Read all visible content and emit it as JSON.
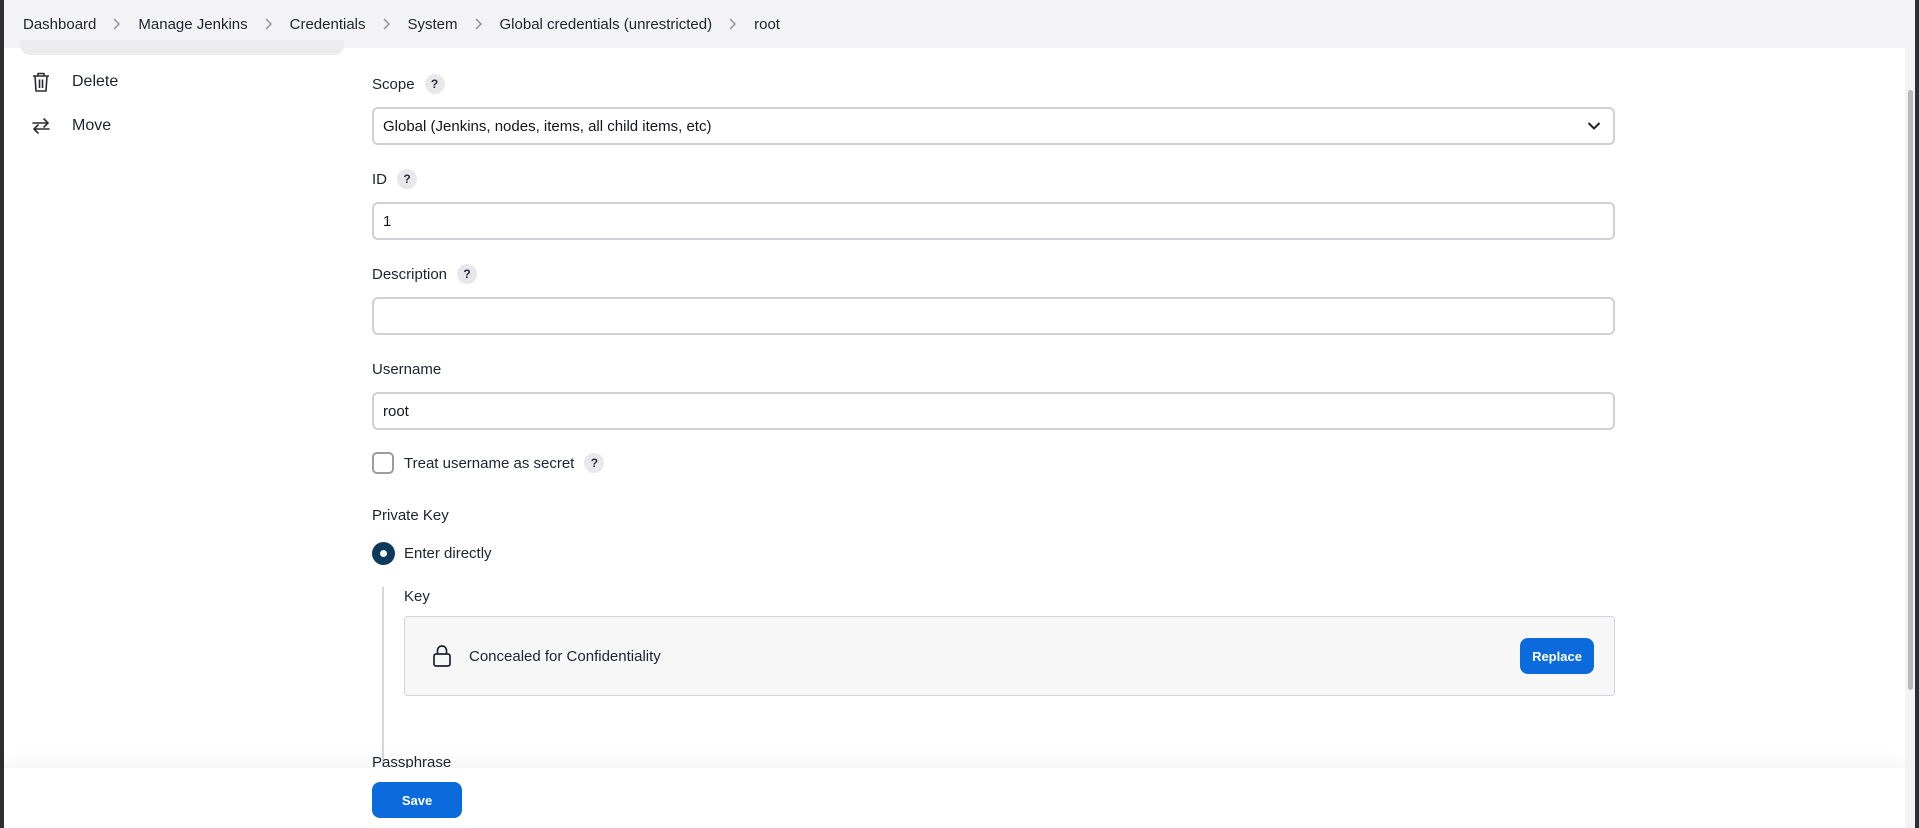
{
  "breadcrumb": [
    {
      "label": "Dashboard"
    },
    {
      "label": "Manage Jenkins"
    },
    {
      "label": "Credentials"
    },
    {
      "label": "System"
    },
    {
      "label": "Global credentials (unrestricted)"
    },
    {
      "label": "root"
    }
  ],
  "sidebar": {
    "items": [
      {
        "label": "Delete",
        "icon": "trash-icon"
      },
      {
        "label": "Move",
        "icon": "arrows-swap-icon"
      }
    ]
  },
  "form": {
    "scope": {
      "label": "Scope",
      "help": "?",
      "value": "Global (Jenkins, nodes, items, all child items, etc)"
    },
    "id": {
      "label": "ID",
      "help": "?",
      "value": "1"
    },
    "description": {
      "label": "Description",
      "help": "?",
      "value": ""
    },
    "username": {
      "label": "Username",
      "value": "root"
    },
    "treat_username_secret": {
      "label": "Treat username as secret",
      "help": "?",
      "checked": false
    },
    "private_key": {
      "label": "Private Key",
      "option_label": "Enter directly",
      "selected": true,
      "key_label": "Key",
      "concealed_text": "Concealed for Confidentiality",
      "replace_label": "Replace"
    },
    "passphrase": {
      "label": "Passphrase"
    }
  },
  "footer": {
    "save_label": "Save"
  },
  "colors": {
    "primary": "#0b6bdc",
    "radio": "#0b3a5c",
    "breadcrumb_bg": "#f3f3f5"
  }
}
